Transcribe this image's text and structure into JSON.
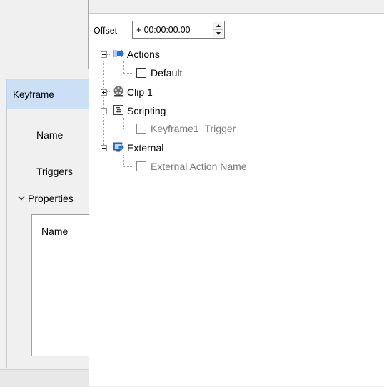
{
  "left_panel": {
    "keyframe_tab": "Keyframe",
    "name_label": "Name",
    "triggers_label": "Triggers",
    "properties_label": "Properties",
    "properties_chevron": "⌄",
    "properties_table_header": "Name"
  },
  "popup": {
    "offset_label": "Offset",
    "offset_value": "+ 00:00:00.00"
  },
  "tree": {
    "actions": {
      "label": "Actions",
      "icon": "arrow-right-icon",
      "expanded": true,
      "children": [
        {
          "label": "Default",
          "checked": false,
          "enabled": true
        }
      ]
    },
    "clip": {
      "label": "Clip 1",
      "icon": "film-reel-icon",
      "expanded": false
    },
    "scripting": {
      "label": "Scripting",
      "icon": "script-icon",
      "expanded": true,
      "children": [
        {
          "label": "Keyframe1_Trigger",
          "checked": false,
          "enabled": false
        }
      ]
    },
    "external": {
      "label": "External",
      "icon": "external-icon",
      "expanded": true,
      "children": [
        {
          "label": "External Action Name",
          "checked": false,
          "enabled": false
        }
      ]
    }
  },
  "colors": {
    "selected_tab": "#cce0f5",
    "disabled_text": "#7a7a7a",
    "arrow_blue": "#1e6fe0"
  }
}
